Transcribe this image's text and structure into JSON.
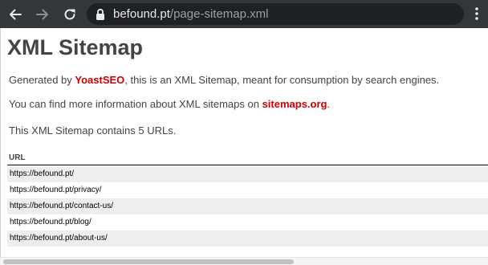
{
  "browser": {
    "url_host": "befound.pt",
    "url_path": "/page-sitemap.xml",
    "icons": {
      "back": "arrow-left-icon",
      "forward": "arrow-right-icon",
      "reload": "reload-icon",
      "lock": "lock-icon",
      "bookmark": "star-icon",
      "menu": "kebab-menu-icon"
    },
    "colors": {
      "toolbar": "#35363a",
      "omnibox": "#202124"
    }
  },
  "page": {
    "title": "XML Sitemap",
    "intro": {
      "prefix": "Generated by ",
      "link": "YoastSEO",
      "suffix": ", this is an XML Sitemap, meant for consumption by search engines."
    },
    "info": {
      "prefix": "You can find more information about XML sitemaps on ",
      "link": "sitemaps.org",
      "suffix": "."
    },
    "count_text": "This XML Sitemap contains 5 URLs.",
    "table": {
      "header": "URL",
      "rows": [
        "https://befound.pt/",
        "https://befound.pt/privacy/",
        "https://befound.pt/contact-us/",
        "https://befound.pt/blog/",
        "https://befound.pt/about-us/"
      ]
    },
    "colors": {
      "link": "#cc0000",
      "text": "#444444",
      "row_alt": "#eeeeee"
    }
  }
}
